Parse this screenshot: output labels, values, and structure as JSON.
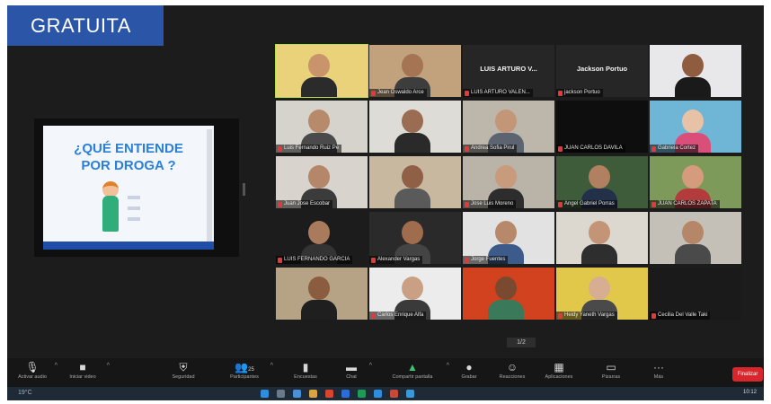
{
  "badge": {
    "label": "GRATUITA"
  },
  "slide": {
    "title": "¿QUÉ ENTIENDE\nPOR DROGA ?"
  },
  "gallery": {
    "tiles": [
      {
        "name": "",
        "big": "",
        "bg": "#e9d27a",
        "skin": "#c9936b",
        "shirt": "#2b2b2b",
        "active": true
      },
      {
        "name": "Jean Oswaldo Arce",
        "big": "",
        "bg": "#c2a27c",
        "skin": "#a57452",
        "shirt": "#3d3d3d"
      },
      {
        "name": "LUIS ARTURO VALEN...",
        "big": "LUIS ARTURO V...",
        "bg": "#262626",
        "empty": true
      },
      {
        "name": "jackson Portuo",
        "big": "Jackson Portuo",
        "bg": "#262626",
        "empty": true
      },
      {
        "name": "",
        "big": "",
        "bg": "#e8e8ea",
        "skin": "#8f5c3f",
        "shirt": "#1a1a1a"
      },
      {
        "name": "Luis Fernando Ruiz Pe",
        "big": "",
        "bg": "#d6d2cc",
        "skin": "#b78a6c",
        "shirt": "#4a4a4a"
      },
      {
        "name": "",
        "big": "",
        "bg": "#dedcd6",
        "skin": "#9a6c52",
        "shirt": "#2a2a2a"
      },
      {
        "name": "Andrea Sofia Pirul",
        "big": "",
        "bg": "#bdb6aa",
        "skin": "#c39677",
        "shirt": "#5b6470"
      },
      {
        "name": "JUAN CARLOS DAVILA",
        "big": "",
        "bg": "#0e0e0e",
        "empty": true
      },
      {
        "name": "Gabriela Cortez",
        "big": "",
        "bg": "#6fb5d6",
        "skin": "#e7c2a6",
        "shirt": "#d94f7a"
      },
      {
        "name": "Juan Jose Escobar",
        "big": "",
        "bg": "#d8d4cd",
        "skin": "#b4876a",
        "shirt": "#3b3b3b"
      },
      {
        "name": "",
        "big": "",
        "bg": "#c9b8a0",
        "skin": "#8f6045",
        "shirt": "#5a5a5a"
      },
      {
        "name": "Jose Luis Moreno",
        "big": "",
        "bg": "#b9b3a8",
        "skin": "#c79b7c",
        "shirt": "#2d2d2d"
      },
      {
        "name": "Angel Gabriel Porras",
        "big": "",
        "bg": "#3e5c3a",
        "skin": "#b08060",
        "shirt": "#22304a"
      },
      {
        "name": "JUAN CARLOS ZAPATA",
        "big": "",
        "bg": "#7d9a5a",
        "skin": "#d49c7c",
        "shirt": "#b33b3b"
      },
      {
        "name": "LUIS FERNANDO GARCIA",
        "big": "",
        "bg": "#1c1c1c",
        "skin": "#a97a5c",
        "shirt": "#333333"
      },
      {
        "name": "Alexander Vargas",
        "big": "",
        "bg": "#2a2a2a",
        "skin": "#a06c4e",
        "shirt": "#444444"
      },
      {
        "name": "Jorge Fuentes",
        "big": "",
        "bg": "#e2e2e2",
        "skin": "#b7896a",
        "shirt": "#3c5a8a"
      },
      {
        "name": "",
        "big": "",
        "bg": "#dcd8d0",
        "skin": "#c49476",
        "shirt": "#2e2e2e"
      },
      {
        "name": "",
        "big": "",
        "bg": "#c4c0b8",
        "skin": "#b58668",
        "shirt": "#4a4a4a"
      },
      {
        "name": "",
        "big": "",
        "bg": "#b6a284",
        "skin": "#8c5c40",
        "shirt": "#1f1f1f"
      },
      {
        "name": "Carlos Enrique Alfa",
        "big": "",
        "bg": "#ececec",
        "skin": "#c9a084",
        "shirt": "#3a3a3a"
      },
      {
        "name": "",
        "big": "",
        "bg": "#d2421e",
        "skin": "#7a4a30",
        "shirt": "#3a7a5a"
      },
      {
        "name": "Heidy Yaneth Vargas",
        "big": "",
        "bg": "#e2c84a",
        "skin": "#d7ae92",
        "shirt": "#4a4a4a"
      },
      {
        "name": "Cecilia Del Valle Taki",
        "big": "",
        "bg": "#1a1a1a",
        "empty": true
      }
    ]
  },
  "page_tab": "1/2",
  "toolbar": {
    "items": [
      {
        "label": "Activar audio",
        "icon": "🎙"
      },
      {
        "label": "Iniciar video",
        "icon": "■"
      },
      {
        "label": "Seguridad",
        "icon": "⛨"
      },
      {
        "label": "Participantes",
        "icon": "👥",
        "count": "25"
      },
      {
        "label": "Encuestas",
        "icon": "▮"
      },
      {
        "label": "Chat",
        "icon": "▬"
      },
      {
        "label": "Compartir pantalla",
        "icon": "▲"
      },
      {
        "label": "Grabar",
        "icon": "●"
      },
      {
        "label": "Reacciones",
        "icon": "☺"
      },
      {
        "label": "Aplicaciones",
        "icon": "▦"
      },
      {
        "label": "Pizarras",
        "icon": "▭"
      },
      {
        "label": "Más",
        "icon": "···"
      }
    ],
    "end_label": "Finalizar"
  },
  "taskbar": {
    "temp": "19°C",
    "clock": "10:12"
  }
}
